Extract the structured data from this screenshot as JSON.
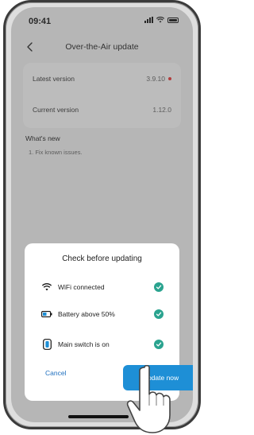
{
  "status": {
    "time": "09:41"
  },
  "header": {
    "title": "Over-the-Air update",
    "back_icon": "chevron-left-icon"
  },
  "versions": {
    "latest_label": "Latest version",
    "latest_value": "3.9.10",
    "current_label": "Current version",
    "current_value": "1.12.0"
  },
  "whats_new": {
    "title": "What's new",
    "items": [
      "1. Fix known issues."
    ]
  },
  "sheet": {
    "title": "Check before updating",
    "checks": [
      {
        "icon": "wifi-icon",
        "label": "WiFi connected"
      },
      {
        "icon": "battery-icon",
        "label": "Battery above 50%"
      },
      {
        "icon": "switch-icon",
        "label": "Main switch is on"
      }
    ],
    "cancel_label": "Cancel",
    "update_label": "Update now"
  },
  "colors": {
    "accent": "#1e8fd6",
    "check_green": "#2aa38f",
    "new_dot": "#e33333"
  }
}
